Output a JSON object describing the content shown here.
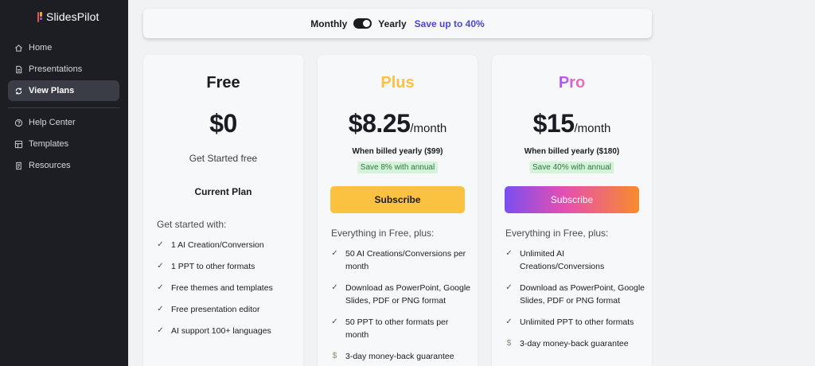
{
  "app": {
    "name": "SlidesPilot"
  },
  "sidebar": {
    "items": [
      {
        "label": "Home",
        "icon": "home-icon",
        "active": false
      },
      {
        "label": "Presentations",
        "icon": "document-icon",
        "active": false
      },
      {
        "label": "View Plans",
        "icon": "refresh-icon",
        "active": true
      },
      {
        "label": "Help Center",
        "icon": "help-icon",
        "active": false
      },
      {
        "label": "Templates",
        "icon": "templates-icon",
        "active": false
      },
      {
        "label": "Resources",
        "icon": "resources-icon",
        "active": false
      }
    ]
  },
  "billing": {
    "monthly_label": "Monthly",
    "yearly_label": "Yearly",
    "save_text": "Save up to 40%",
    "selected": "Yearly"
  },
  "plans": {
    "free": {
      "name": "Free",
      "price": "$0",
      "tagline": "Get Started free",
      "status": "Current Plan",
      "features_heading": "Get started with:",
      "features": [
        "1 AI Creation/Conversion",
        "1 PPT to other formats",
        "Free themes and templates",
        "Free presentation editor",
        "AI support 100+ languages"
      ]
    },
    "plus": {
      "name": "Plus",
      "price": "$8.25",
      "per": "/month",
      "billed": "When billed yearly ($99)",
      "save_badge": "Save 8% with annual",
      "cta": "Subscribe",
      "features_heading": "Everything in Free, plus:",
      "features": [
        {
          "text": "50 AI Creations/Conversions per month",
          "icon": "check"
        },
        {
          "text": "Download as PowerPoint, Google Slides, PDF or PNG format",
          "icon": "check"
        },
        {
          "text": "50 PPT to other formats per month",
          "icon": "check"
        },
        {
          "text": "3-day money-back guarantee",
          "icon": "dollar"
        }
      ]
    },
    "pro": {
      "name": "Pro",
      "price": "$15",
      "per": "/month",
      "billed": "When billed yearly ($180)",
      "save_badge": "Save 40% with annual",
      "cta": "Subscribe",
      "features_heading": "Everything in Free, plus:",
      "features": [
        {
          "text": "Unlimited AI Creations/Conversions",
          "icon": "check"
        },
        {
          "text": "Download as PowerPoint, Google Slides, PDF or PNG format",
          "icon": "check"
        },
        {
          "text": "Unlimited PPT to other formats",
          "icon": "check"
        },
        {
          "text": "3-day money-back guarantee",
          "icon": "dollar"
        }
      ]
    }
  },
  "colors": {
    "sidebar_bg": "#1c1e24",
    "plus_accent": "#fbc141",
    "pro_gradient": [
      "#7a4ff0",
      "#e64fb0",
      "#f78c2a"
    ],
    "save_text": "#4b45d6",
    "badge_bg": "#d6f2db"
  }
}
